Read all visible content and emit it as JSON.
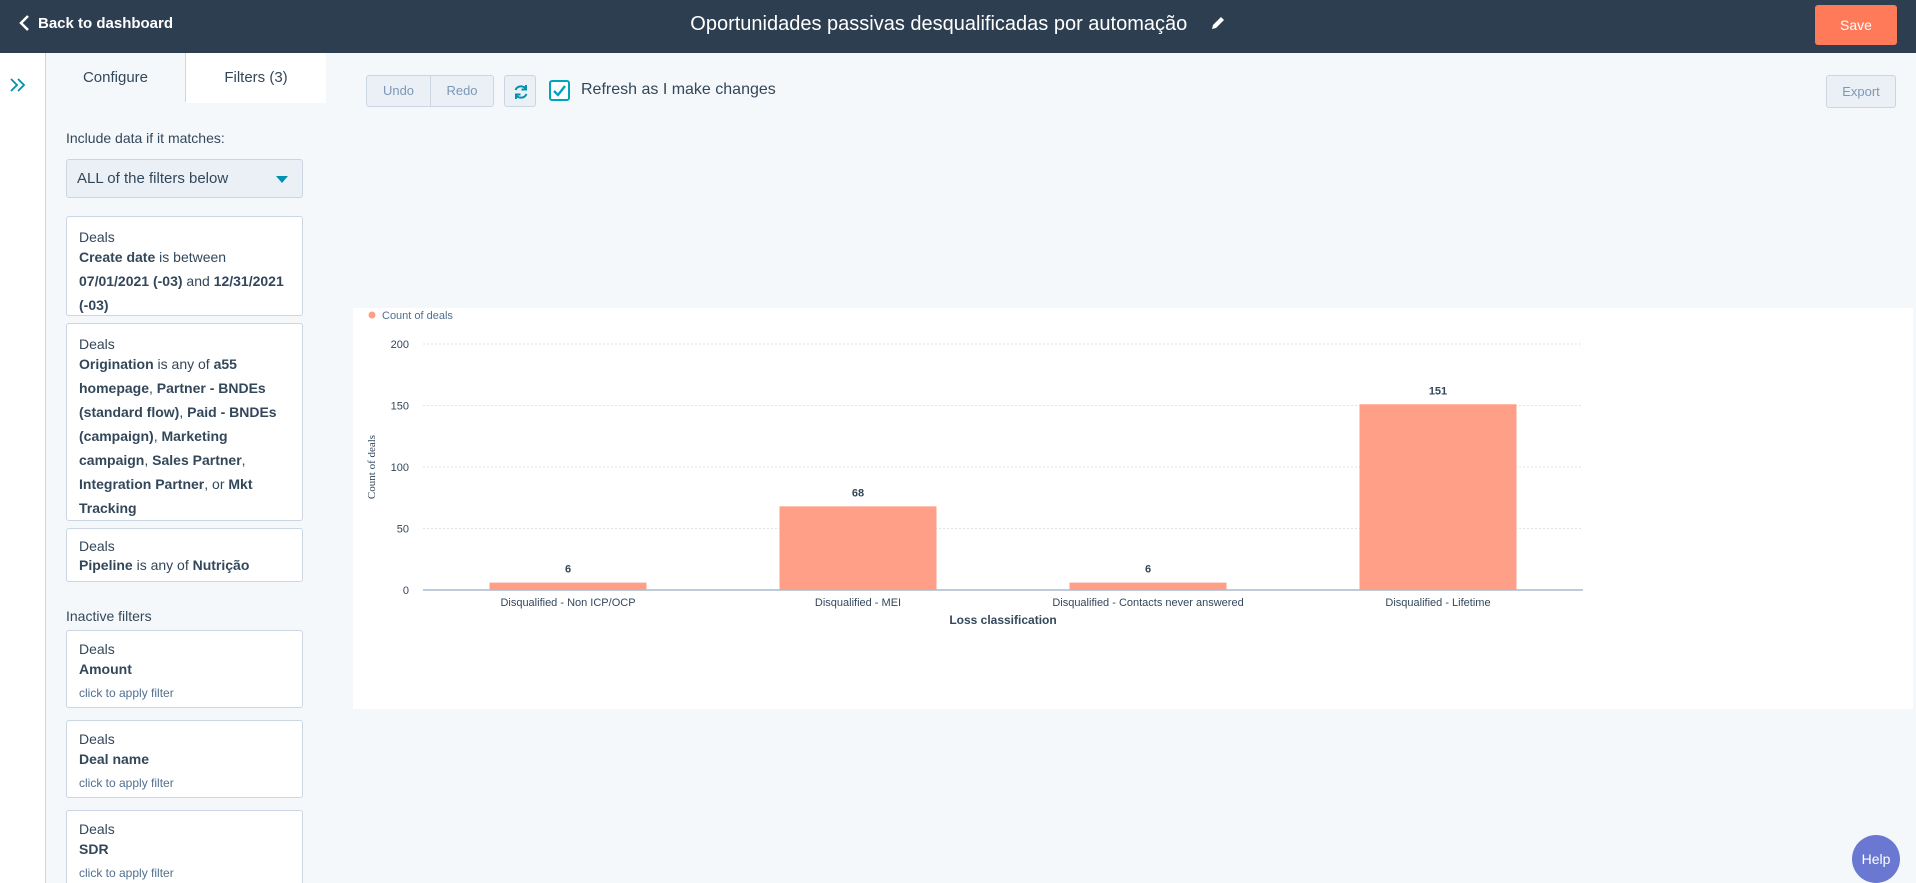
{
  "header": {
    "back_label": "Back to dashboard",
    "title": "Oportunidades passivas desqualificadas por automação",
    "save_label": "Save"
  },
  "panel": {
    "tabs": [
      "Configure",
      "Filters (3)"
    ],
    "match_label": "Include data if it matches:",
    "match_value": "ALL of the filters below",
    "filters": [
      {
        "object": "Deals",
        "parts": [
          {
            "text": "Create date",
            "bold": true
          },
          {
            "text": " is between ",
            "bold": false
          },
          {
            "text": "07/01/2021 (-03)",
            "bold": true
          },
          {
            "text": " and ",
            "bold": false
          },
          {
            "text": "12/31/2021 (-03)",
            "bold": true
          }
        ]
      },
      {
        "object": "Deals",
        "parts": [
          {
            "text": "Origination",
            "bold": true
          },
          {
            "text": " is any of ",
            "bold": false
          },
          {
            "text": "a55 homepage",
            "bold": true
          },
          {
            "text": ", ",
            "bold": false
          },
          {
            "text": "Partner - BNDEs (standard flow)",
            "bold": true
          },
          {
            "text": ", ",
            "bold": false
          },
          {
            "text": "Paid - BNDEs (campaign)",
            "bold": true
          },
          {
            "text": ", ",
            "bold": false
          },
          {
            "text": "Marketing campaign",
            "bold": true
          },
          {
            "text": ", ",
            "bold": false
          },
          {
            "text": "Sales Partner",
            "bold": true
          },
          {
            "text": ", ",
            "bold": false
          },
          {
            "text": "Integration Partner",
            "bold": true
          },
          {
            "text": ", or ",
            "bold": false
          },
          {
            "text": "Mkt Tracking",
            "bold": true
          }
        ]
      },
      {
        "object": "Deals",
        "parts": [
          {
            "text": "Pipeline",
            "bold": true
          },
          {
            "text": " is any of ",
            "bold": false
          },
          {
            "text": "Nutrição",
            "bold": true
          }
        ]
      }
    ],
    "inactive_label": "Inactive filters",
    "inactive": [
      {
        "object": "Deals",
        "property": "Amount",
        "hint": "click to apply filter"
      },
      {
        "object": "Deals",
        "property": "Deal name",
        "hint": "click to apply filter"
      },
      {
        "object": "Deals",
        "property": "SDR",
        "hint": "click to apply filter"
      }
    ]
  },
  "toolbar": {
    "undo_label": "Undo",
    "redo_label": "Redo",
    "refresh_label": "Refresh as I make changes",
    "refresh_checked": true,
    "export_label": "Export"
  },
  "chart_data": {
    "type": "bar",
    "categories": [
      "Disqualified - Non ICP/OCP",
      "Disqualified - MEI",
      "Disqualified - Contacts never answered",
      "Disqualified - Lifetime"
    ],
    "series": [
      {
        "name": "Count of deals",
        "values": [
          6,
          68,
          6,
          151
        ]
      }
    ],
    "xlabel": "Loss classification",
    "ylabel": "Count of deals",
    "ylim": [
      0,
      200
    ],
    "yticks": [
      0,
      50,
      100,
      150,
      200
    ],
    "bar_color": "#ff9f87",
    "grid": true,
    "legend_position": "top-left"
  },
  "help_label": "Help",
  "colors": {
    "header_bg": "#2d3e50",
    "accent": "#ff7a59",
    "teal": "#00a4bd"
  }
}
